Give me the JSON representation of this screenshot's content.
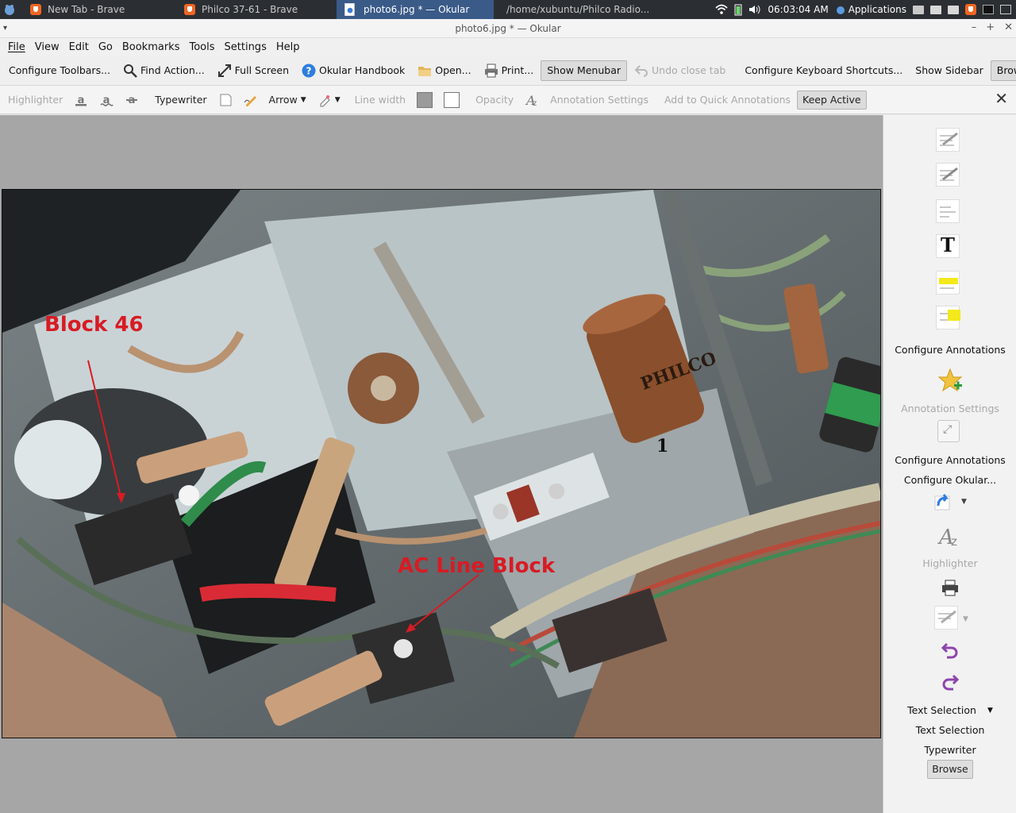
{
  "panel": {
    "tasks": [
      {
        "label": "New Tab - Brave",
        "icon": "brave-icon"
      },
      {
        "label": "Philco 37-61 - Brave",
        "icon": "brave-icon"
      },
      {
        "label": "photo6.jpg * — Okular",
        "icon": "okular-icon"
      },
      {
        "label": "/home/xubuntu/Philco Radio...",
        "icon": "folder-icon"
      }
    ],
    "clock": "06:03:04 AM",
    "applications_label": "Applications"
  },
  "window": {
    "title": "photo6.jpg * — Okular"
  },
  "menubar": {
    "items": [
      "File",
      "View",
      "Edit",
      "Go",
      "Bookmarks",
      "Tools",
      "Settings",
      "Help"
    ]
  },
  "toolbar": {
    "configure_toolbars": "Configure Toolbars...",
    "find_action": "Find Action...",
    "full_screen": "Full Screen",
    "handbook": "Okular Handbook",
    "open": "Open...",
    "print": "Print...",
    "show_menubar": "Show Menubar",
    "undo_close_tab": "Undo close tab",
    "configure_shortcuts": "Configure Keyboard Shortcuts...",
    "show_sidebar": "Show Sidebar",
    "browse": "Browse",
    "overflow": "»"
  },
  "annotation_bar": {
    "highlighter": "Highlighter",
    "typewriter": "Typewriter",
    "arrow": "Arrow",
    "line_width": "Line width",
    "opacity": "Opacity",
    "annotation_settings": "Annotation Settings",
    "add_quick": "Add to Quick Annotations",
    "keep_active": "Keep Active",
    "line_color": "#9a9a9a",
    "fill_color": "#ffffff"
  },
  "document": {
    "image_labels": [
      "Block 46",
      "AC Line Block"
    ],
    "annotation_color": "#d81b24",
    "marking_1": "1",
    "capacitor_text": "PHILCO"
  },
  "sidebar": {
    "configure_annotations_1": "Configure Annotations",
    "annotation_settings": "Annotation Settings",
    "configure_annotations_2": "Configure Annotations",
    "configure_okular": "Configure Okular...",
    "highlighter": "Highlighter",
    "text_selection_dropdown": "Text Selection",
    "text_selection": "Text Selection",
    "typewriter": "Typewriter",
    "browse": "Browse"
  }
}
